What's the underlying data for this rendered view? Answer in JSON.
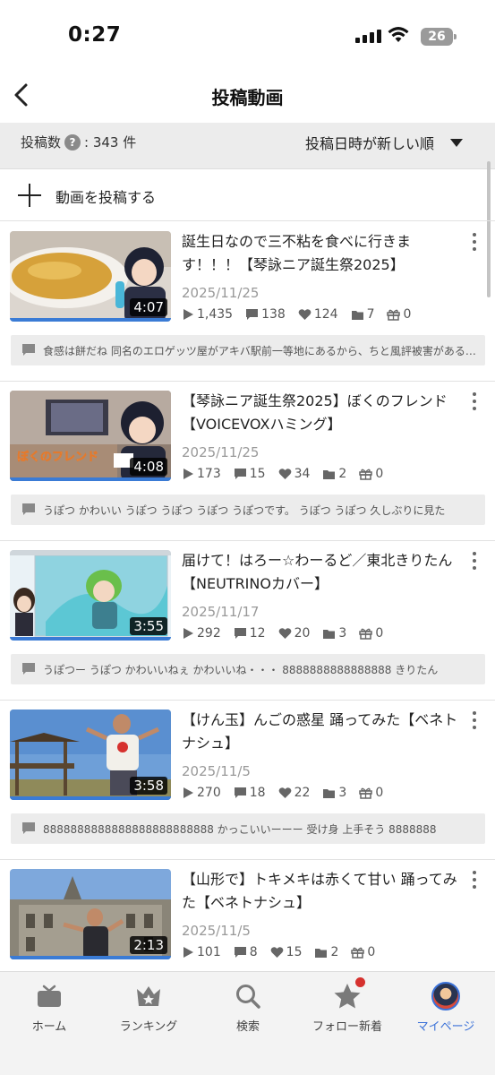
{
  "status_bar": {
    "time": "0:27",
    "battery": "26"
  },
  "header": {
    "title": "投稿動画"
  },
  "summary": {
    "count_label": "投稿数",
    "help": "?",
    "count_value": ": 343 件",
    "sort_label": "投稿日時が新しい順"
  },
  "post_action": {
    "label": "動画を投稿する"
  },
  "videos": [
    {
      "title": "誕生日なので三不粘を食べに行きます！！！【琴詠ニア誕生祭2025】",
      "duration": "4:07",
      "date": "2025/11/25",
      "views": "1,435",
      "comments": "138",
      "likes": "124",
      "mylists": "7",
      "gifts": "0",
      "latest_comment": "食感は餅だね 同名のエロゲッツ屋がアキバ駅前一等地にあるから、ちと風評被害があるかもしれない"
    },
    {
      "title": "【琴詠ニア誕生祭2025】ぼくのフレンド【VOICEVOXハミング】",
      "duration": "4:08",
      "date": "2025/11/25",
      "views": "173",
      "comments": "15",
      "likes": "34",
      "mylists": "2",
      "gifts": "0",
      "latest_comment": "うぽつ かわいい うぽつ うぽつ うぽつ うぽつです。 うぽつ うぽつ 久しぶりに見た"
    },
    {
      "title": "届けて！はろー☆わーるど／東北きりたん【NEUTRINOカバー】",
      "duration": "3:55",
      "date": "2025/11/17",
      "views": "292",
      "comments": "12",
      "likes": "20",
      "mylists": "3",
      "gifts": "0",
      "latest_comment": "うぽつー うぽつ かわいいねぇ かわいいね・・・ 8888888888888888 きりたん"
    },
    {
      "title": "【けん玉】んごの惑星 踊ってみた【ベネトナシュ】",
      "duration": "3:58",
      "date": "2025/11/5",
      "views": "270",
      "comments": "18",
      "likes": "22",
      "mylists": "3",
      "gifts": "0",
      "latest_comment": "8888888888888888888888888 かっこいいーーー 受け身 上手そう 8888888"
    },
    {
      "title": "【山形で】トキメキは赤くて甘い 踊ってみた【ベネトナシュ】",
      "duration": "2:13",
      "date": "2025/11/5",
      "views": "101",
      "comments": "8",
      "likes": "15",
      "mylists": "2",
      "gifts": "0",
      "latest_comment": ""
    }
  ],
  "tabbar": {
    "home": "ホーム",
    "ranking": "ランキング",
    "search": "検索",
    "follow": "フォロー新着",
    "mypage": "マイページ"
  },
  "colors": {
    "accent": "#3c72d8",
    "progress": "#3a7bd5",
    "badge": "#d6312e"
  }
}
